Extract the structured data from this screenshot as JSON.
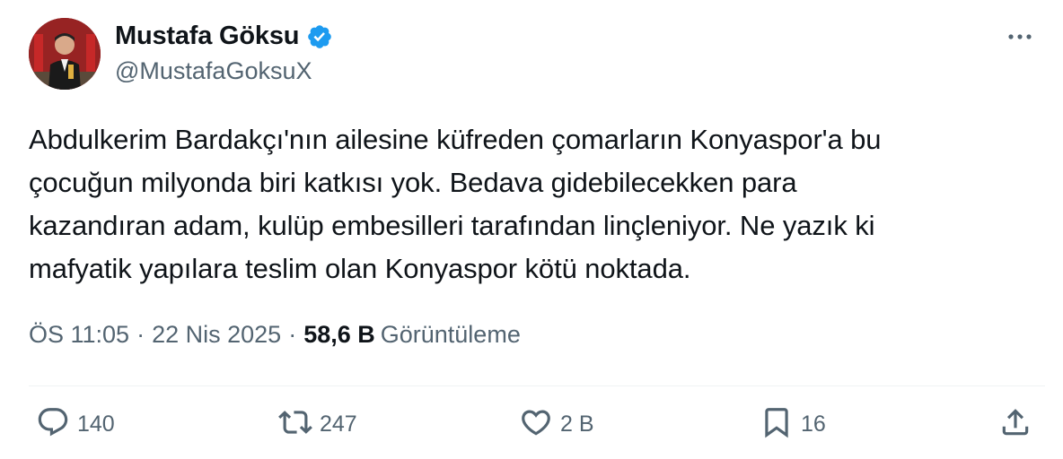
{
  "tweet": {
    "author": {
      "display_name": "Mustafa Göksu",
      "handle": "@MustafaGoksuX",
      "verified": true,
      "verified_color": "#1d9bf0"
    },
    "text": "Abdulkerim Bardakçı'nın ailesine küfreden çomarların Konyaspor'a bu\nçocuğun milyonda biri katkısı yok. Bedava gidebilecekken para\nkazandıran adam, kulüp embesilleri tarafından linçleniyor. Ne yazık ki\nmafyatik yapılara teslim olan Konyaspor kötü noktada.",
    "meta": {
      "time": "ÖS 11:05",
      "separator": "·",
      "date": "22 Nis 2025",
      "views_count": "58,6 B",
      "views_label": "Görüntüleme"
    },
    "actions": {
      "replies": "140",
      "retweets": "247",
      "likes": "2 B",
      "bookmarks": "16"
    },
    "icons": [
      "more-icon",
      "reply-icon",
      "retweet-icon",
      "like-icon",
      "bookmark-icon",
      "share-icon",
      "verified-badge-icon"
    ],
    "colors": {
      "text": "#0f1419",
      "secondary": "#536471",
      "divider": "#eff3f4"
    }
  }
}
